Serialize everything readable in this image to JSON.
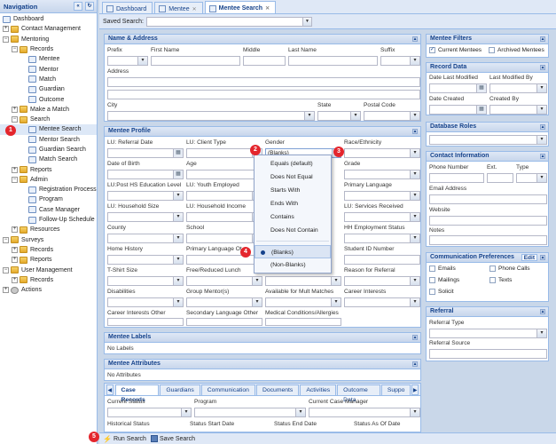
{
  "nav": {
    "title": "Navigation",
    "items": [
      "Dashboard",
      "Contact Management",
      "Mentoring",
      "Records",
      "Mentee",
      "Mentor",
      "Match",
      "Guardian",
      "Outcome",
      "Make a Match",
      "Search",
      "Mentee Search",
      "Mentor Search",
      "Guardian Search",
      "Match Search",
      "Reports",
      "Admin",
      "Registration Process",
      "Program",
      "Case Manager",
      "Follow-Up Schedule",
      "Resources",
      "Surveys",
      "Records",
      "Reports",
      "User Management",
      "Records",
      "Actions"
    ]
  },
  "tabs": [
    "Dashboard",
    "Mentee",
    "Mentee Search"
  ],
  "saved_search": {
    "label": "Saved Search:",
    "value": ""
  },
  "name_address": {
    "title": "Name & Address",
    "prefix": "Prefix",
    "first": "First Name",
    "middle": "Middle",
    "last": "Last Name",
    "suffix": "Suffix",
    "address": "Address",
    "city": "City",
    "state": "State",
    "postal": "Postal Code"
  },
  "profile": {
    "title": "Mentee Profile",
    "referral_date": "LU: Referral Date",
    "client_type": "LU: Client Type",
    "gender": "Gender",
    "gender_value": "(Blanks)",
    "race": "Race/Ethnicity",
    "dob": "Date of Birth",
    "age": "Age",
    "grade": "Grade",
    "post_hs": "LU:Post HS Education Level",
    "youth_employed": "LU: Youth Employed",
    "primary_lang": "Primary Language",
    "household_size": "LU: Household Size",
    "household_income": "LU: Household Income",
    "services_received": "LU: Services Received",
    "county": "County",
    "school": "School",
    "hh_employment": "HH Employment Status",
    "home_history": "Home History",
    "primary_lang_other": "Primary Language Ot",
    "student_id": "Student ID Number",
    "tshirt": "T-Shirt Size",
    "free_lunch": "Free/Reduced Lunch",
    "reason_referral": "Reason for Referral",
    "disabilities": "Disabilities",
    "group_mentors": "Group Mentor(s)",
    "available_mult": "Available for Mult Matches",
    "career_interests": "Career Interests",
    "career_other": "Career Interests Other",
    "secondary_lang": "Secondary Language Other",
    "medical": "Medical Conditions/Allergies"
  },
  "filter_menu": {
    "items": [
      "Equals (default)",
      "Does Not Equal",
      "Starts With",
      "Ends With",
      "Contains",
      "Does Not Contain"
    ],
    "blanks": "(Blanks)",
    "nonblanks": "(Non-Blanks)"
  },
  "labels": {
    "title": "Mentee Labels",
    "value": "No Labels"
  },
  "attributes": {
    "title": "Mentee Attributes",
    "value": "No Attributes"
  },
  "subtabs": [
    "Case Records",
    "Guardians",
    "Communication",
    "Documents",
    "Activities",
    "Outcome Data",
    "Suppo"
  ],
  "case_records": {
    "status": "Current Status",
    "program": "Program",
    "case_manager": "Current Case Manager",
    "historical": "Historical Status",
    "start": "Status Start Date",
    "end": "Status End Date",
    "as_of": "Status As Of Date"
  },
  "filters": {
    "title": "Mentee Filters",
    "current": "Current Mentees",
    "archived": "Archived Mentees"
  },
  "record_data": {
    "title": "Record Data",
    "last_modified": "Date Last Modified",
    "last_modified_by": "Last Modified By",
    "created": "Date Created",
    "created_by": "Created By"
  },
  "db_roles": {
    "title": "Database Roles"
  },
  "contact": {
    "title": "Contact Information",
    "phone": "Phone Number",
    "ext": "Ext.",
    "type": "Type",
    "email": "Email Address",
    "website": "Website",
    "notes": "Notes"
  },
  "comm_prefs": {
    "title": "Communication Preferences",
    "edit": "Edit",
    "emails": "Emails",
    "phone": "Phone Calls",
    "mailings": "Mailings",
    "texts": "Texts",
    "solicit": "Solicit"
  },
  "referral": {
    "title": "Referral",
    "type": "Referral Type",
    "source": "Referral Source"
  },
  "footer": {
    "run": "Run Search",
    "save": "Save Search"
  },
  "badges": [
    "1",
    "2",
    "3",
    "4",
    "5"
  ]
}
